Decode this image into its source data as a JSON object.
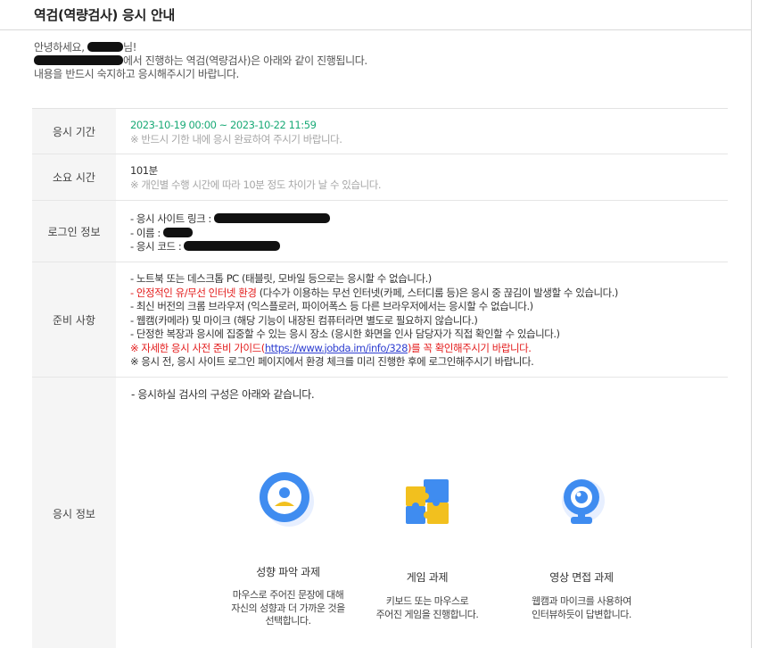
{
  "page": {
    "title": "역검(역량검사) 응시 안내",
    "greeting_prefix": "안녕하세요, ",
    "greeting_suffix": "님!",
    "intro_line2_suffix": "에서 진행하는 역검(역량검사)은 아래와 같이 진행됩니다.",
    "intro_line3": "내용을 반드시 숙지하고 응시해주시기 바랍니다."
  },
  "rows": {
    "period": {
      "label": "응시 기간",
      "date_range": "2023-10-19 00:00 ~ 2023-10-22 11:59",
      "note": "※ 반드시 기한 내에 응시 완료하여 주시기 바랍니다."
    },
    "duration": {
      "label": "소요 시간",
      "value": "101분",
      "note": "※ 개인별 수행 시간에 따라 10분 정도 차이가 날 수 있습니다."
    },
    "login": {
      "label": "로그인 정보",
      "site_link": "- 응시 사이트 링크 : ",
      "name": "- 이름 : ",
      "code": "- 응시 코드 : "
    },
    "prep": {
      "label": "준비 사항",
      "l1_main": "- 노트북 또는 데스크톱 PC",
      "l1_note": " (태블릿, 모바일 등으로는 응시할 수 없습니다.)",
      "l2_main": "- 안정적인 유/무선 인터넷 환경",
      "l2_note": " (다수가 이용하는 무선 인터넷(카페, 스터디룸 등)은 응시 중 끊김이 발생할 수 있습니다.)",
      "l3_main": "- 최신 버전의 크롬 브라우저",
      "l3_note": " (익스플로러, 파이어폭스 등 다른 브라우저에서는 응시할 수 없습니다.)",
      "l4_main": "- 웹캠(카메라) 및 마이크",
      "l4_note": " (해당 기능이 내장된 컴퓨터라면 별도로 필요하지 않습니다.)",
      "l5_main": "- 단정한 복장과 응시에 집중할 수 있는 응시 장소",
      "l5_note": " (응시한 화면을 인사 담당자가 직접 확인할 수 있습니다.)",
      "l6_pre": "※ 자세한 응시 사전 준비 가이드(",
      "l6_link": "https://www.jobda.im/info/328",
      "l6_post": ")를 꼭 확인해주시기 바랍니다.",
      "l7": "※ 응시 전, 응시 사이트 로그인 페이지에서 환경 체크를 미리 진행한 후에 로그인해주시기 바랍니다."
    },
    "info": {
      "label": "응시 정보",
      "structure": "- 응시하실 검사의 구성은 아래와 같습니다.",
      "cards": [
        {
          "name": "성향 파악 과제",
          "desc1": "마우스로 주어진 문장에 대해",
          "desc2": "자신의 성향과 더 가까운 것을",
          "desc3": "선택합니다.",
          "icon": "person-icon",
          "color": "#3f8cf0"
        },
        {
          "name": "게임 과제",
          "desc1": "키보드 또는 마우스로",
          "desc2": "주어진 게임을 진행합니다.",
          "icon": "puzzle-icon",
          "color": "#f2c01e"
        },
        {
          "name": "영상 면접 과제",
          "desc1": "웹캠과 마이크를 사용하여",
          "desc2": "인터뷰하듯이 답변합니다.",
          "icon": "webcam-icon",
          "color": "#3f8cf0"
        }
      ]
    }
  }
}
